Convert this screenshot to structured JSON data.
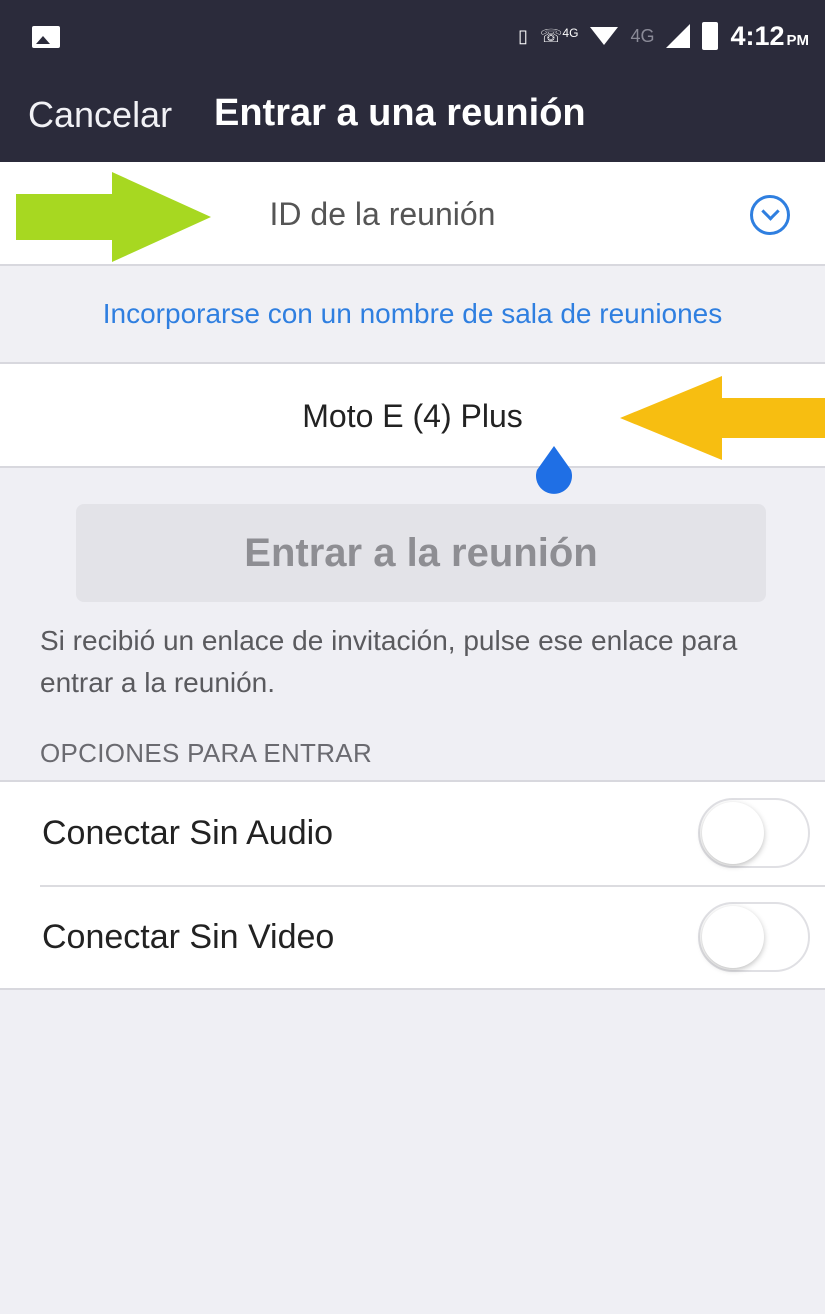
{
  "status_bar": {
    "network_left": "4G",
    "network_right": "4G",
    "time": "4:12",
    "time_suffix": "PM"
  },
  "header": {
    "cancel_label": "Cancelar",
    "title": "Entrar a una reunión"
  },
  "form": {
    "meeting_id_placeholder": "ID de la reunión",
    "room_name_link": "Incorporarse con un nombre de sala de reuniones",
    "name_value": "Moto E (4) Plus",
    "join_button_label": "Entrar a la reunión"
  },
  "info_text": "Si recibió un enlace de invitación, pulse ese enlace para entrar a la reunión.",
  "options": {
    "header": "OPCIONES PARA ENTRAR",
    "items": [
      {
        "label": "Conectar Sin Audio"
      },
      {
        "label": "Conectar Sin Video"
      }
    ]
  },
  "colors": {
    "header_bg": "#2b2b3b",
    "accent_blue": "#2f7fe0",
    "green_arrow": "#a7d821",
    "yellow_arrow": "#f7be11"
  },
  "icons": {
    "dropdown": "chevron-circle-down-icon",
    "cursor": "text-cursor-handle-icon"
  }
}
